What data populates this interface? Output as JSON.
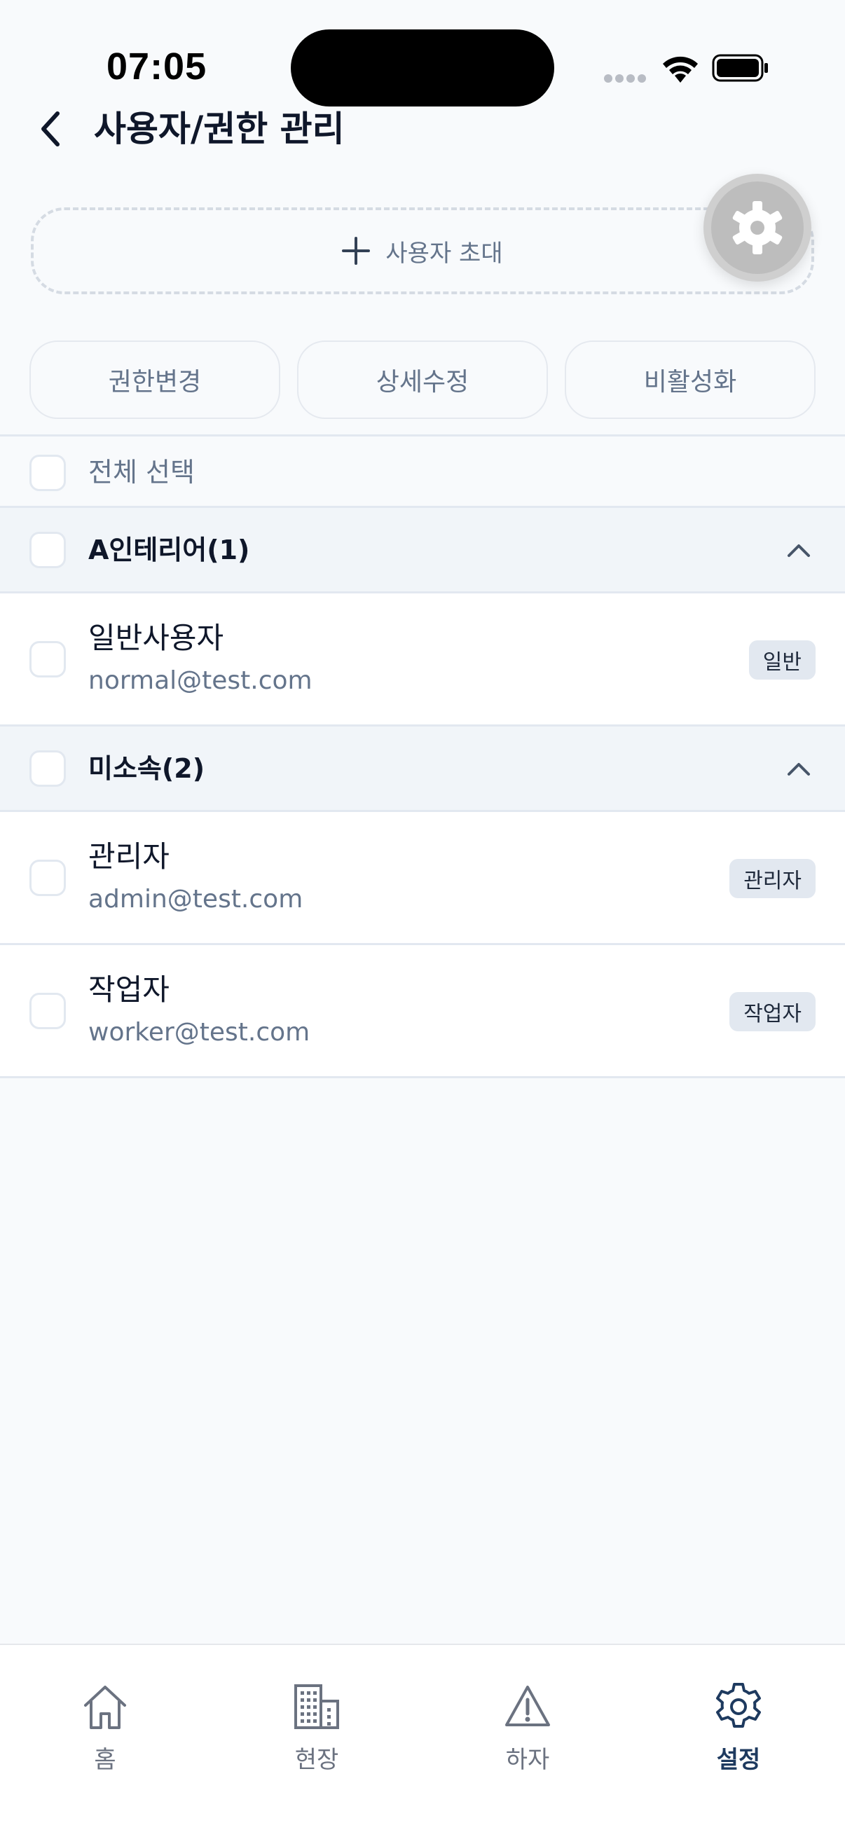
{
  "status_bar": {
    "time": "07:05"
  },
  "header": {
    "title": "사용자/권한 관리"
  },
  "invite": {
    "label": "사용자 초대"
  },
  "actions": [
    {
      "label": "권한변경"
    },
    {
      "label": "상세수정"
    },
    {
      "label": "비활성화"
    }
  ],
  "list": {
    "select_all_label": "전체 선택",
    "groups": [
      {
        "title": "A인테리어(1)",
        "users": [
          {
            "name": "일반사용자",
            "email": "normal@test.com",
            "role": "일반"
          }
        ]
      },
      {
        "title": "미소속(2)",
        "users": [
          {
            "name": "관리자",
            "email": "admin@test.com",
            "role": "관리자"
          },
          {
            "name": "작업자",
            "email": "worker@test.com",
            "role": "작업자"
          }
        ]
      }
    ]
  },
  "bottom_nav": {
    "items": [
      {
        "label": "홈",
        "icon": "home-icon"
      },
      {
        "label": "현장",
        "icon": "building-icon"
      },
      {
        "label": "하자",
        "icon": "warning-icon"
      },
      {
        "label": "설정",
        "icon": "gear-icon",
        "active": true
      }
    ]
  },
  "colors": {
    "background": "#f8fafc",
    "text_primary": "#0f172a",
    "text_muted": "#64748b",
    "active_nav": "#1e3a5f"
  }
}
